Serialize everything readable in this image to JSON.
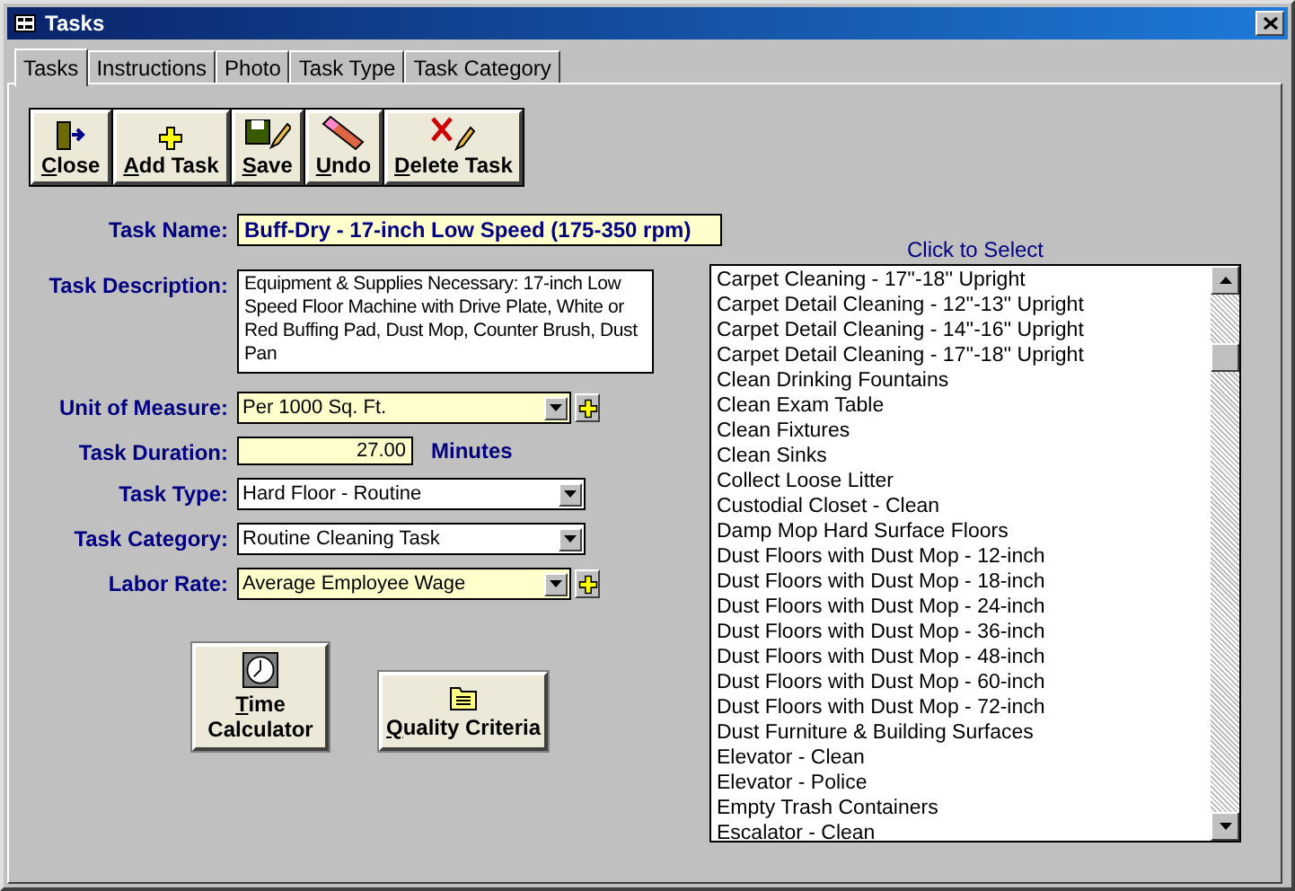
{
  "window": {
    "title": "Tasks"
  },
  "tabs": [
    {
      "label": "Tasks",
      "selected": true
    },
    {
      "label": "Instructions",
      "selected": false
    },
    {
      "label": "Photo",
      "selected": false
    },
    {
      "label": "Task Type",
      "selected": false
    },
    {
      "label": "Task Category",
      "selected": false
    }
  ],
  "toolbar": [
    {
      "label": "Close",
      "kind": "close"
    },
    {
      "label": "Add Task",
      "kind": "add"
    },
    {
      "label": "Save",
      "kind": "save"
    },
    {
      "label": "Undo",
      "kind": "undo"
    },
    {
      "label": "Delete Task",
      "kind": "delete"
    }
  ],
  "fields": [
    {
      "label": "Task Name:",
      "kind": "text",
      "value": "Buff-Dry - 17-inch Low Speed (175-350 rpm)",
      "highlighted": true
    },
    {
      "label": "Task Description:",
      "kind": "memo",
      "value": "Equipment & Supplies Necessary:  17-inch Low Speed Floor Machine with Drive Plate, White or Red Buffing Pad, Dust Mop, Counter Brush, Dust Pan",
      "highlighted": false
    },
    {
      "label": "Unit of Measure:",
      "kind": "combo",
      "value": "Per 1000 Sq. Ft.",
      "highlighted": true,
      "add_button": true
    },
    {
      "label": "Task Duration:",
      "kind": "number",
      "value": "27.00",
      "unit": "Minutes",
      "highlighted": true
    },
    {
      "label": "Task Type:",
      "kind": "combo",
      "value": "Hard Floor - Routine",
      "highlighted": false,
      "add_button": false
    },
    {
      "label": "Task Category:",
      "kind": "combo",
      "value": "Routine Cleaning Task",
      "highlighted": false,
      "add_button": false
    },
    {
      "label": "Labor Rate:",
      "kind": "combo",
      "value": "Average Employee Wage",
      "highlighted": true,
      "add_button": true
    }
  ],
  "actions": [
    {
      "label": "Time Calculator",
      "kind": "clock"
    },
    {
      "label": "Quality Criteria",
      "kind": "folder"
    }
  ],
  "task_list": {
    "header": "Click to Select",
    "items": [
      "Carpet Cleaning - 17''-18'' Upright",
      "Carpet Detail Cleaning - 12''-13'' Upright",
      "Carpet Detail Cleaning - 14''-16'' Upright",
      "Carpet Detail Cleaning - 17''-18'' Upright",
      "Clean Drinking Fountains",
      "Clean Exam Table",
      "Clean Fixtures",
      "Clean Sinks",
      "Collect Loose Litter",
      "Custodial Closet - Clean",
      "Damp Mop Hard Surface Floors",
      "Dust Floors with Dust Mop - 12-inch",
      "Dust Floors with Dust Mop - 18-inch",
      "Dust Floors with Dust Mop - 24-inch",
      "Dust Floors with Dust Mop - 36-inch",
      "Dust Floors with Dust Mop - 48-inch",
      "Dust Floors with Dust Mop - 60-inch",
      "Dust Floors with Dust Mop - 72-inch",
      "Dust Furniture & Building Surfaces",
      "Elevator - Clean",
      "Elevator - Police",
      "Empty Trash Containers",
      "Escalator - Clean"
    ]
  }
}
